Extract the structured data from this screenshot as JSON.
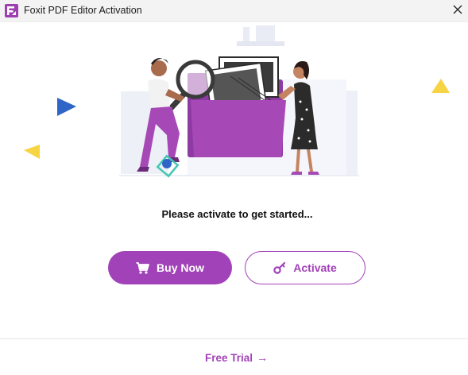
{
  "window": {
    "title": "Foxit PDF Editor Activation",
    "logo_icon": "foxit-logo-icon",
    "close_icon": "close-icon"
  },
  "main": {
    "prompt": "Please activate to get started...",
    "buy_button": {
      "label": "Buy Now",
      "icon": "cart-icon"
    },
    "activate_button": {
      "label": "Activate",
      "icon": "key-icon"
    }
  },
  "footer": {
    "free_trial_label": "Free Trial",
    "free_trial_arrow": "→"
  },
  "colors": {
    "accent": "#a142b8",
    "title_bg": "#f3f3f3",
    "triangle_blue": "#2f65c7",
    "triangle_yellow": "#f7d443",
    "folder_purple": "#a649b6"
  }
}
